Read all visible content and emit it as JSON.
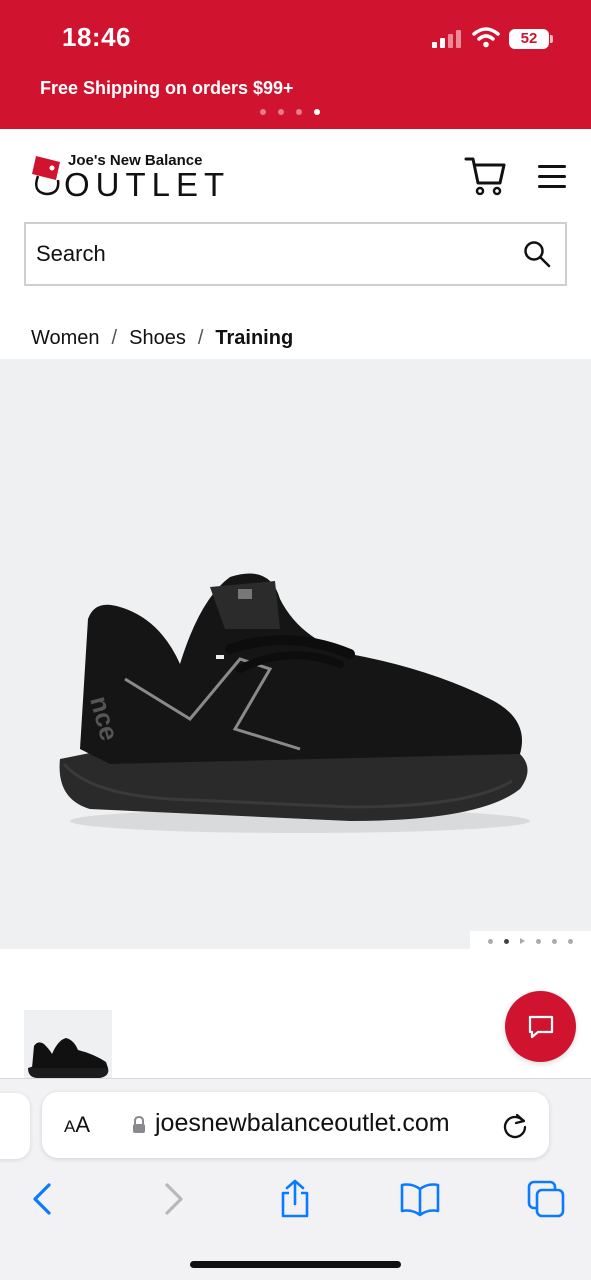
{
  "status_bar": {
    "time": "18:46",
    "battery": "52"
  },
  "promo": {
    "text": "Free Shipping on orders $99+",
    "slide_count": 4,
    "active_slide": 4
  },
  "header": {
    "logo_top": "Joe's New Balance",
    "logo_bottom": "OUTLET",
    "cart_icon": "cart-icon",
    "menu_icon": "hamburger-menu-icon"
  },
  "search": {
    "placeholder": "Search",
    "icon": "search-icon"
  },
  "breadcrumb": {
    "items": [
      "Women",
      "Shoes",
      "Training"
    ],
    "separator": "/"
  },
  "gallery": {
    "image_count": 6,
    "active_index": 2
  },
  "chat": {
    "icon": "chat-icon"
  },
  "browser": {
    "aa_label_small": "A",
    "aa_label_large": "A",
    "url": "joesnewbalanceoutlet.com",
    "reload_icon": "reload-icon",
    "toolbar": [
      "back-icon",
      "forward-icon",
      "share-icon",
      "bookmarks-icon",
      "tabs-icon"
    ]
  },
  "colors": {
    "brand_red": "#d0142f",
    "safari_blue": "#0a7aff"
  }
}
